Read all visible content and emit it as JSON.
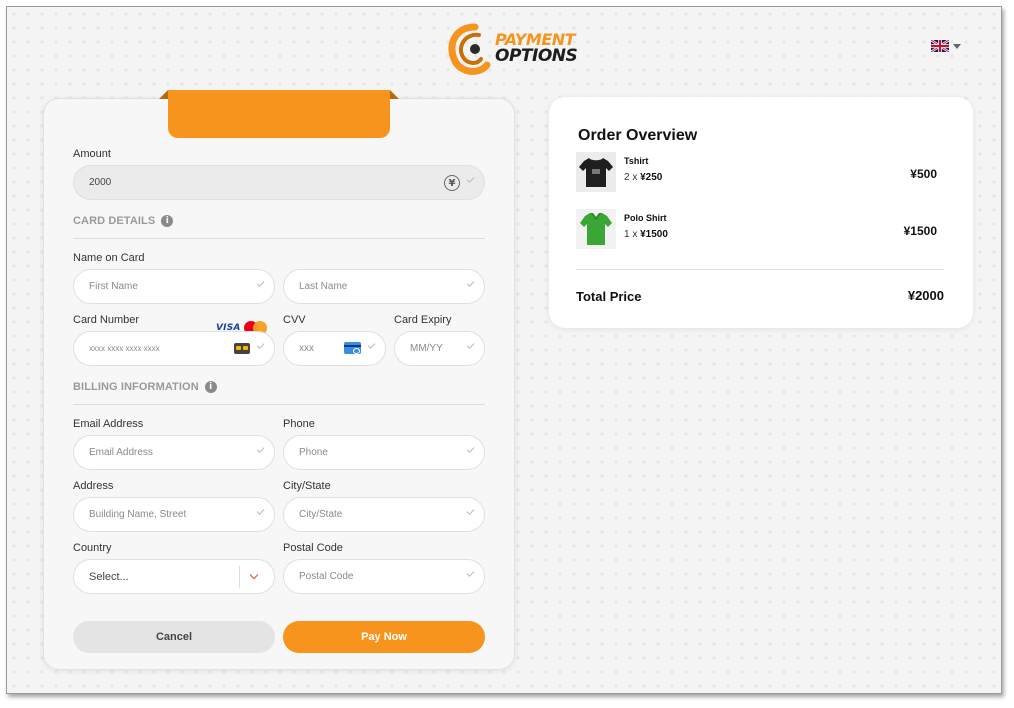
{
  "brand": {
    "line1": "PAYMENT",
    "line2": "OPTIONS",
    "accent": "#f7941d"
  },
  "language": {
    "icon": "uk-flag-icon"
  },
  "form": {
    "amount": {
      "label": "Amount",
      "value": "2000",
      "currency_icon": "yen-circle-icon"
    },
    "card_details": {
      "title": "CARD DETAILS",
      "name_on_card_label": "Name on Card",
      "first_name_placeholder": "First Name",
      "last_name_placeholder": "Last Name",
      "card_number_label": "Card Number",
      "card_brands": [
        "VISA",
        "Mastercard"
      ],
      "card_number_placeholder": "xxxx xxxx xxxx xxxx",
      "cvv_label": "CVV",
      "cvv_placeholder": "xxx",
      "expiry_label": "Card Expiry",
      "expiry_placeholder": "MM/YY"
    },
    "billing": {
      "title": "BILLING INFORMATION",
      "email_label": "Email Address",
      "email_placeholder": "Email Address",
      "phone_label": "Phone",
      "phone_placeholder": "Phone",
      "address_label": "Address",
      "address_placeholder": "Building Name, Street",
      "city_label": "City/State",
      "city_placeholder": "City/State",
      "country_label": "Country",
      "country_value": "Select...",
      "postal_label": "Postal Code",
      "postal_placeholder": "Postal Code"
    },
    "cancel_label": "Cancel",
    "pay_label": "Pay Now"
  },
  "order": {
    "title": "Order Overview",
    "items": [
      {
        "name": "Tshirt",
        "qty": "2",
        "unit_price": "¥250",
        "total": "¥500",
        "color": "#1f1f1f"
      },
      {
        "name": "Polo Shirt",
        "qty": "1",
        "unit_price": "¥1500",
        "total": "¥1500",
        "color": "#3aa635"
      }
    ],
    "total_label": "Total Price",
    "total_value": "¥2000"
  }
}
